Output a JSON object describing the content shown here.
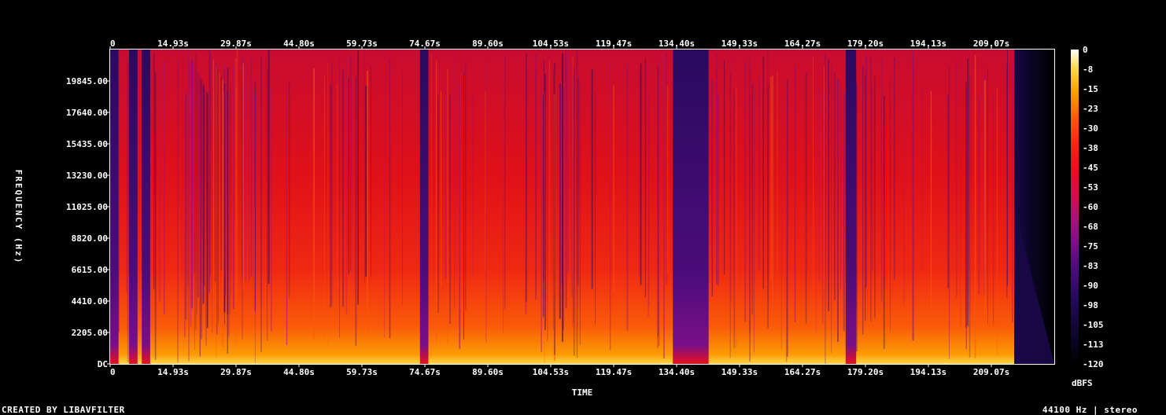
{
  "chart_data": {
    "type": "heatmap",
    "title": "",
    "xlabel": "TIME",
    "ylabel": "FREQUENCY (Hz)",
    "xlim": [
      0,
      224
    ],
    "ylim": [
      0,
      22050
    ],
    "x_ticks": [
      "0",
      "14.93s",
      "29.87s",
      "44.80s",
      "59.73s",
      "74.67s",
      "89.60s",
      "104.53s",
      "119.47s",
      "134.40s",
      "149.33s",
      "164.27s",
      "179.20s",
      "194.13s",
      "209.07s"
    ],
    "x_tick_values": [
      0,
      14.93,
      29.87,
      44.8,
      59.73,
      74.67,
      89.6,
      104.53,
      119.47,
      134.4,
      149.33,
      164.27,
      179.2,
      194.13,
      209.07
    ],
    "y_ticks": [
      "DC",
      "2205.00",
      "4410.00",
      "6615.00",
      "8820.00",
      "11025.00",
      "13230.00",
      "15435.00",
      "17640.00",
      "19845.00"
    ],
    "y_tick_values": [
      0,
      2205,
      4410,
      6615,
      8820,
      11025,
      13230,
      15435,
      17640,
      19845
    ],
    "colorbar": {
      "label": "dBFS",
      "ticks": [
        "0",
        "-8",
        "-15",
        "-23",
        "-30",
        "-38",
        "-45",
        "-53",
        "-60",
        "-68",
        "-75",
        "-83",
        "-90",
        "-98",
        "-105",
        "-113",
        "-120"
      ],
      "range": [
        -120,
        0
      ]
    },
    "quiet_segments_s": [
      [
        0,
        2
      ],
      [
        4.5,
        6.5
      ],
      [
        7.5,
        9.5
      ],
      [
        73.5,
        75.5
      ],
      [
        133.5,
        142
      ],
      [
        174.5,
        177
      ],
      [
        214.5,
        224
      ]
    ]
  },
  "footer": {
    "left": "CREATED BY LIBAVFILTER",
    "right": "44100 Hz | stereo"
  },
  "colors": {
    "background": "#000000",
    "text": "#ffffff",
    "colormap": [
      "#000000",
      "#0b0526",
      "#23095b",
      "#4a0c7a",
      "#7a0e8a",
      "#a8107a",
      "#d0104c",
      "#e8101f",
      "#f02812",
      "#fa5a08",
      "#fc9a04",
      "#ffd84a",
      "#ffffff"
    ]
  }
}
